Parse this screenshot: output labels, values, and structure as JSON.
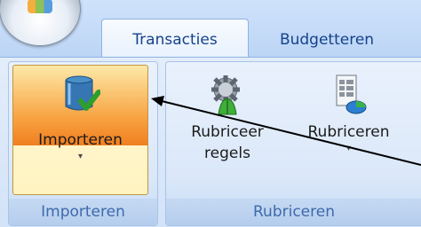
{
  "tabs": [
    {
      "label": "Transacties",
      "active": true
    },
    {
      "label": "Budgetteren",
      "active": false
    }
  ],
  "groups": {
    "importeren": {
      "label": "Importeren",
      "button": {
        "label": "Importeren",
        "icon": "database-import-icon"
      }
    },
    "rubriceren": {
      "label": "Rubriceren",
      "buttons": [
        {
          "line1": "Rubriceer",
          "line2": "regels",
          "icon": "rules-gear-icon"
        },
        {
          "label": "Rubriceren",
          "icon": "document-categorize-icon"
        }
      ]
    }
  },
  "dropdown_glyph": "▾",
  "colors": {
    "ribbon_blue": "#bfdbff",
    "tab_text": "#15428b",
    "active_button_orange": "#f07f20",
    "arrow": "#000000"
  }
}
